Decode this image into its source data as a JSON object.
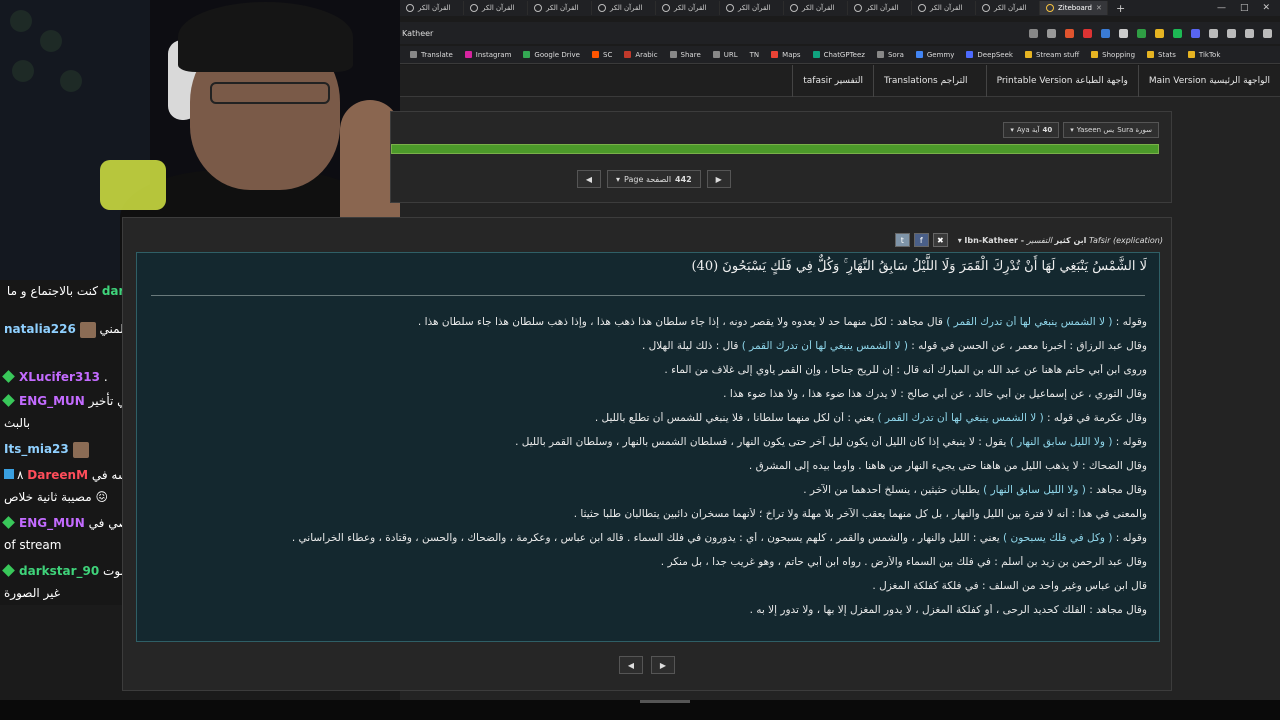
{
  "browser": {
    "tabs": [
      {
        "title": "القرآن الكر"
      },
      {
        "title": "القرآن الكر"
      },
      {
        "title": "القرآن الكر"
      },
      {
        "title": "القرآن الكر"
      },
      {
        "title": "القرآن الكر"
      },
      {
        "title": "القرآن الكر"
      },
      {
        "title": "القرآن الكر"
      },
      {
        "title": "القرآن الكر"
      },
      {
        "title": "القرآن الكر"
      },
      {
        "title": "القرآن الكر"
      },
      {
        "title": "القرآن الكر"
      }
    ],
    "active_tab": {
      "title": "Ziteboard"
    },
    "new_tab_label": "+",
    "window_controls": [
      "—",
      "□",
      "✕"
    ],
    "address": "Katheer",
    "bookmarks": [
      {
        "label": "Translate"
      },
      {
        "label": "Instagram"
      },
      {
        "label": "Google Drive"
      },
      {
        "label": "SC"
      },
      {
        "label": "Arabic"
      },
      {
        "label": "Share"
      },
      {
        "label": "URL"
      },
      {
        "label": "TN"
      },
      {
        "label": "Maps"
      },
      {
        "label": "ChatGPTeez"
      },
      {
        "label": "Sora"
      },
      {
        "label": "Gemmy"
      },
      {
        "label": "DeepSeek"
      },
      {
        "label": "Stream stuff"
      },
      {
        "label": "Shopping"
      },
      {
        "label": "Stats"
      },
      {
        "label": "TikTok"
      }
    ]
  },
  "nav": {
    "main": "Main Version الواجهة الرئيسية",
    "printable": "Printable Version واجهة الطباعة",
    "translations": "Translations التراجم",
    "tafsir": "tafasir التفسير"
  },
  "controls": {
    "sura_label": "Sura سورة",
    "sura_value": "Yaseen يس",
    "aya_label": "Aya آية",
    "aya_value": "40",
    "page_label": "Page الصفحة",
    "page_value": "442",
    "prev": "◀",
    "next": "▶",
    "progress_percent": 100
  },
  "tafsir": {
    "source_label": "التفسير Tafsir (explication)",
    "source_name": "Ibn-Katheer - ابن كثير",
    "close_label": "✖",
    "fb_label": "f",
    "tw_label": "t",
    "verse": "لَا الشَّمْسُ يَنْبَغِي لَهَا أَنْ تُدْرِكَ الْقَمَرَ وَلَا اللَّيْلُ سَابِقُ النَّهَارِ ۚ وَكُلٌّ فِي فَلَكٍ يَسْبَحُونَ (40)",
    "lines": [
      {
        "a": "وقوله : ",
        "q": "( لا الشمس ينبغي لها أن تدرك القمر )",
        "b": " قال مجاهد : لكل منهما حد لا يعدوه ولا يقصر دونه ، إذا جاء سلطان هذا ذهب هذا ، وإذا ذهب سلطان هذا جاء سلطان هذا ."
      },
      {
        "a": "وقال عبد الرزاق : أخبرنا معمر ، عن الحسن في قوله : ",
        "q": "( لا الشمس ينبغي لها أن تدرك القمر )",
        "b": " قال : ذلك ليلة الهلال ."
      },
      {
        "a": "وروى ابن أبي حاتم هاهنا عن عبد الله بن المبارك أنه قال : إن للريح جناحا ، وإن القمر يأوي إلى غلاف من الماء .",
        "q": "",
        "b": ""
      },
      {
        "a": "وقال الثوري ، عن إسماعيل بن أبي خالد ، عن أبي صالح : لا يدرك هذا ضوء هذا ، ولا هذا ضوء هذا .",
        "q": "",
        "b": ""
      },
      {
        "a": "وقال عكرمة في قوله : ",
        "q": "( لا الشمس ينبغي لها أن تدرك القمر )",
        "b": " يعني : أن لكل منهما سلطانا ، فلا ينبغي للشمس أن تطلع بالليل ."
      },
      {
        "a": "وقوله : ",
        "q": "( ولا الليل سابق النهار )",
        "b": " يقول : لا ينبغي إذا كان الليل أن يكون ليل آخر حتى يكون النهار ، فسلطان الشمس بالنهار ، وسلطان القمر بالليل ."
      },
      {
        "a": "وقال الضحاك : لا يذهب الليل من هاهنا حتى يجيء النهار من هاهنا . وأومأ بيده إلى المشرق .",
        "q": "",
        "b": ""
      },
      {
        "a": "وقال مجاهد : ",
        "q": "( ولا الليل سابق النهار )",
        "b": " يطلبان حثيثين ، ينسلخ أحدهما من الآخر ."
      },
      {
        "a": "والمعنى في هذا : أنه لا فترة بين الليل والنهار ، بل كل منهما يعقب الآخر بلا مهلة ولا تراخ ؛ لأنهما مسخران دائبين يتطالبان طلبا حثيثا .",
        "q": "",
        "b": ""
      },
      {
        "a": "وقوله : ",
        "q": "( وكل في فلك يسبحون )",
        "b": " يعني : الليل والنهار ، والشمس والقمر ، كلهم يسبحون ، أي : يدورون في فلك السماء . قاله ابن عباس ، وعكرمة ، والضحاك ، والحسن ، وقتادة ، وعطاء الخراساني ."
      },
      {
        "a": "وقال عبد الرحمن بن زيد بن أسلم : في فلك بين السماء والأرض . رواه ابن أبي حاتم ، وهو غريب جدا ، بل منكر .",
        "q": "",
        "b": ""
      },
      {
        "a": "قال ابن عباس وغير واحد من السلف : في فلكة كفلكة المغزل .",
        "q": "",
        "b": ""
      },
      {
        "a": "وقال مجاهد : الفلك كحديد الرحى ، أو كفلكة المغزل ، لا يدور المغزل إلا بها ، ولا تدور إلا به .",
        "q": "",
        "b": ""
      }
    ]
  },
  "chat": {
    "messages": [
      {
        "user": "darkstar_90",
        "text": "كنت بالاجتماع و ما أجمعو",
        "color": "#3fd37a"
      },
      {
        "user": "natalia226",
        "text": "تتكلم عن المني",
        "color": "#8fd0ff"
      },
      {
        "user": "XLucifer313",
        "text": ".",
        "color": "#c36bff"
      },
      {
        "user": "ENG_MUN",
        "text": "قصي في تأخير بالبث",
        "color": "#c36bff"
      },
      {
        "user": "Its_mia23",
        "text": "",
        "color": "#8fd0ff"
      },
      {
        "user": "DareenM",
        "text": "هو لسه في مصيبة ثانية خلاص 😖",
        "color": "#ff4d5a",
        "badge": "٨"
      },
      {
        "user": "ENG_MUN",
        "text": "قصي في delay of stream",
        "color": "#c36bff"
      },
      {
        "user": "darkstar_90",
        "text": "صح ..الصوت غير الصورة",
        "color": "#3fd37a"
      }
    ]
  }
}
